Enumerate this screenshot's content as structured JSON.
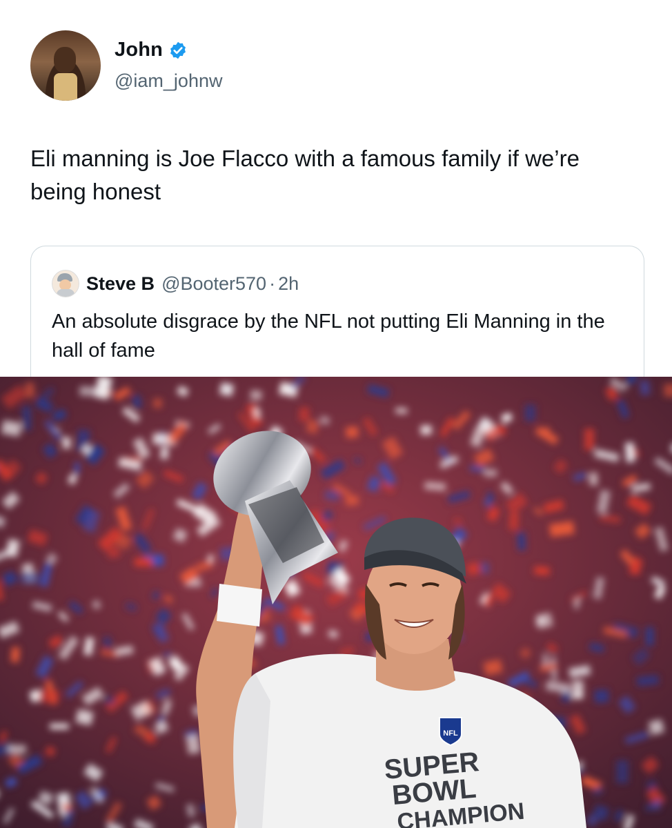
{
  "tweet": {
    "author_name": "John",
    "author_handle": "@iam_johnw",
    "verified_icon": "verified-badge-icon",
    "text": "Eli manning is Joe Flacco with a famous family if we’re being honest"
  },
  "quoted_tweet": {
    "author_name": "Steve B",
    "author_handle": "@Booter570",
    "separator": "·",
    "time": "2h",
    "text": "An absolute disgrace by the NFL not putting Eli Manning in the hall of fame"
  },
  "photo": {
    "shirt_text_line1": "SUPER",
    "shirt_text_line2": "BOWL",
    "shirt_text_line3": "CHAMPION",
    "shirt_logo": "NFL"
  },
  "colors": {
    "verified": "#1d9bf0",
    "secondary_text": "#536471",
    "border": "#cfd9de",
    "confetti_red": "#d63a2e",
    "confetti_blue": "#3f4fb4"
  }
}
